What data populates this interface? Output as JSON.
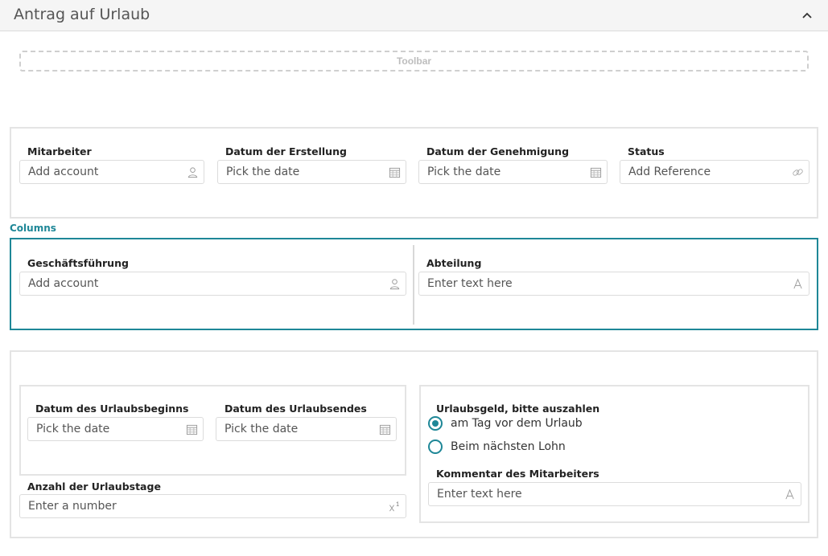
{
  "header": {
    "title": "Antrag auf Urlaub"
  },
  "toolbar": {
    "label": "Toolbar"
  },
  "row1": {
    "mitarbeiter": {
      "label": "Mitarbeiter",
      "placeholder": "Add account"
    },
    "erstellung": {
      "label": "Datum der Erstellung",
      "placeholder": "Pick the date"
    },
    "genehmigung": {
      "label": "Datum der Genehmigung",
      "placeholder": "Pick the date"
    },
    "status": {
      "label": "Status",
      "placeholder": "Add Reference"
    }
  },
  "columns": {
    "caption": "Columns",
    "geschaeftsfuehrung": {
      "label": "Geschäftsführung",
      "placeholder": "Add account"
    },
    "abteilung": {
      "label": "Abteilung",
      "placeholder": "Enter text here"
    }
  },
  "vacation": {
    "beginn": {
      "label": "Datum des Urlaubsbeginns",
      "placeholder": "Pick the date"
    },
    "ende": {
      "label": "Datum des Urlaubsendes",
      "placeholder": "Pick the date"
    },
    "tage": {
      "label": "Anzahl der Urlaubstage",
      "placeholder": "Enter a number"
    },
    "urlaubsgeld": {
      "label": "Urlaubsgeld, bitte auszahlen",
      "options": [
        {
          "label": "am Tag vor dem Urlaub",
          "selected": true
        },
        {
          "label": "Beim nächsten Lohn",
          "selected": false
        }
      ]
    },
    "kommentar": {
      "label": "Kommentar des Mitarbeiters",
      "placeholder": "Enter text here"
    }
  },
  "icons": {
    "account": "person-icon",
    "date": "calendar-icon",
    "reference": "link-icon",
    "text": "text-format-icon",
    "number": "superscript-number-icon",
    "collapse": "chevron-up-icon"
  },
  "colors": {
    "accent": "#1e8797",
    "border": "#e4e4e4",
    "header_bg": "#f5f5f5"
  }
}
